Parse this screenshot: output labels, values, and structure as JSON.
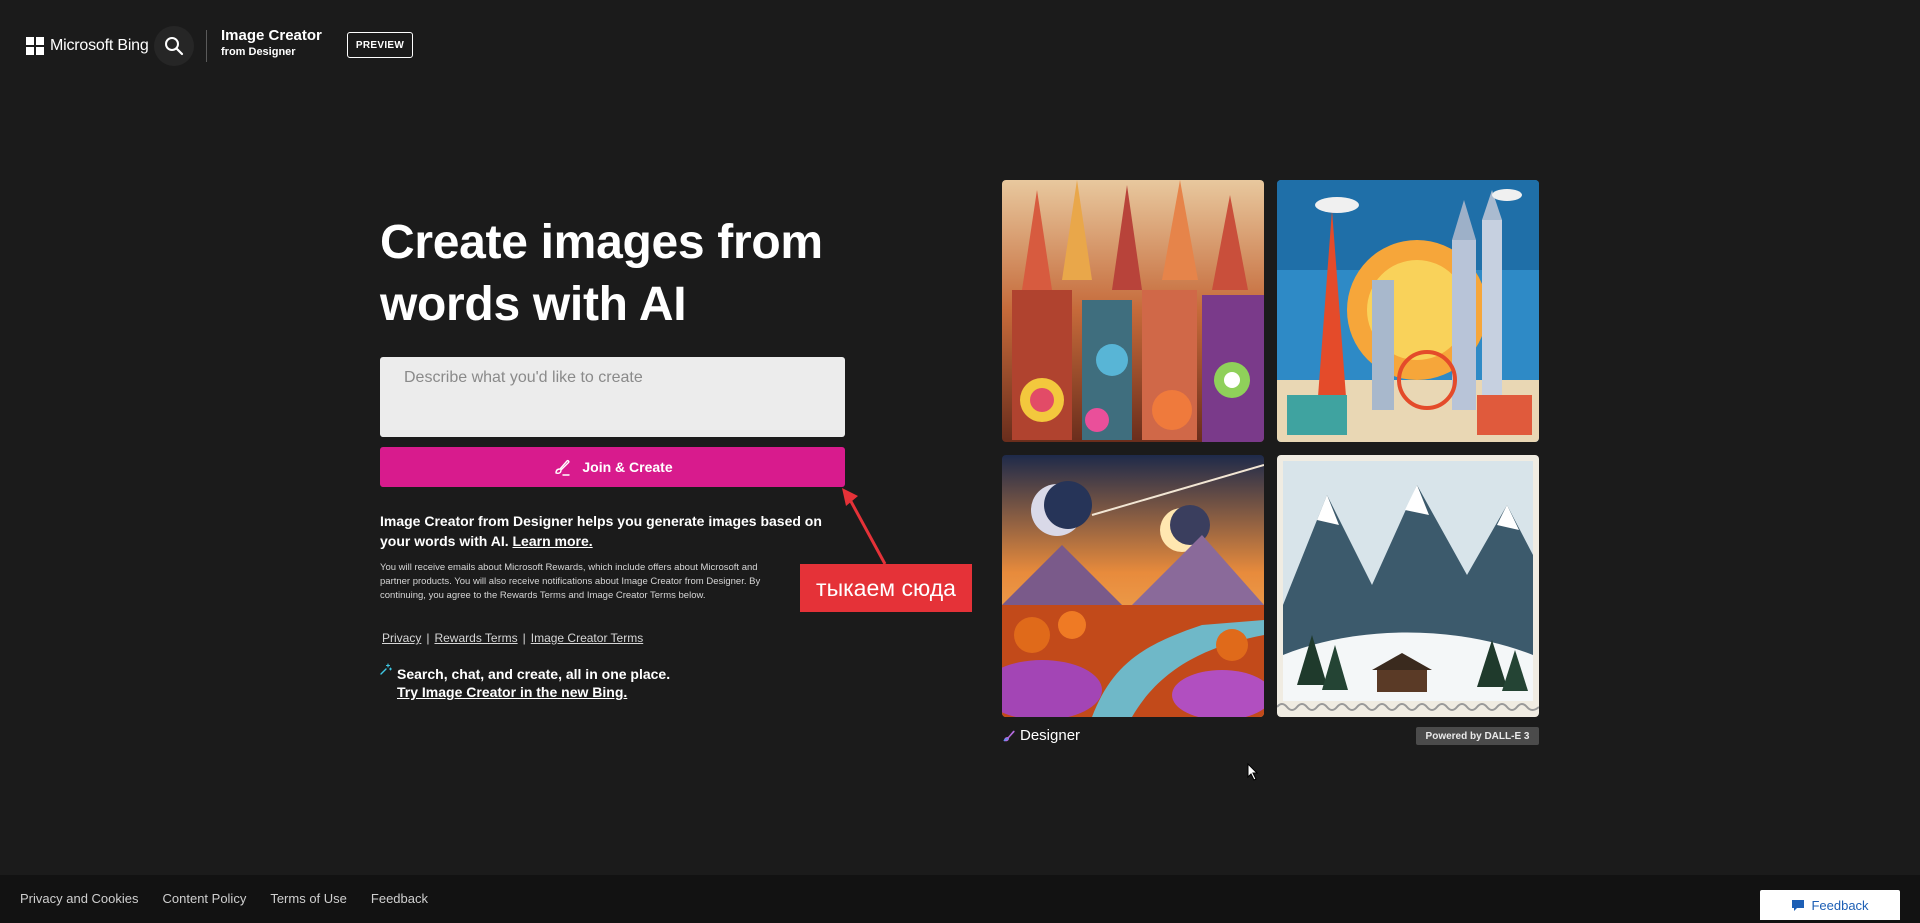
{
  "header": {
    "brand_label": "Microsoft Bing",
    "product_title": "Image Creator",
    "product_subtitle": "from Designer",
    "preview_badge": "PREVIEW"
  },
  "hero": {
    "title_line1": "Create images from",
    "title_line2": "words with AI"
  },
  "prompt": {
    "placeholder": "Describe what you'd like to create",
    "value": ""
  },
  "create_button": {
    "label": "Join & Create"
  },
  "description": {
    "text": "Image Creator from Designer helps you generate images based on your words with AI.",
    "learn_more": "Learn more."
  },
  "fine_print": "You will receive emails about Microsoft Rewards, which include offers about Microsoft and partner products. You will also receive notifications about Image Creator from Designer. By continuing, you agree to the Rewards Terms and Image Creator Terms below.",
  "legal_links": {
    "privacy": "Privacy",
    "rewards_terms": "Rewards Terms",
    "image_creator_terms": "Image Creator Terms",
    "separator": "|"
  },
  "promo": {
    "text": "Search, chat, and create, all in one place.",
    "link": "Try Image Creator in the new Bing."
  },
  "annotation": {
    "label": "тыкаем сюда",
    "color": "#e53238"
  },
  "gallery": {
    "designer_label": "Designer",
    "powered_by": "Powered by DALL-E 3"
  },
  "footer": {
    "links": [
      "Privacy and Cookies",
      "Content Policy",
      "Terms of Use",
      "Feedback"
    ],
    "feedback_button": "Feedback"
  },
  "colors": {
    "background": "#1b1b1b",
    "accent": "#d81b8d",
    "footer": "#121212"
  }
}
